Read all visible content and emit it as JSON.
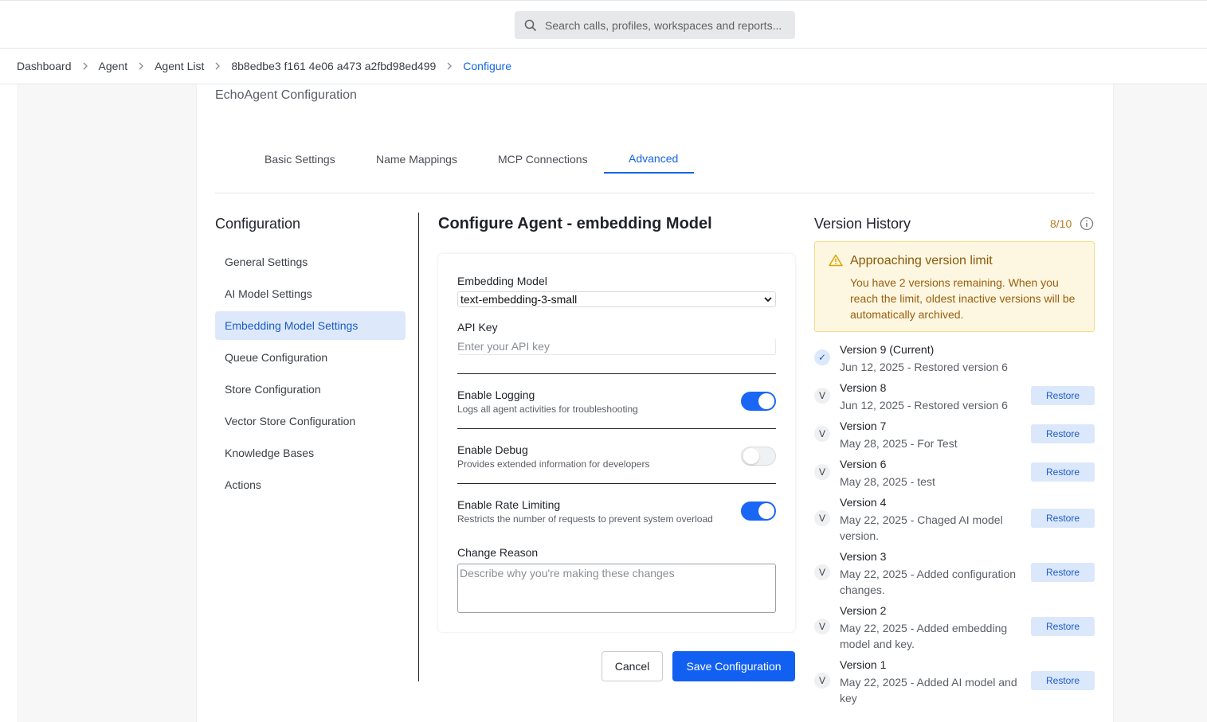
{
  "search": {
    "placeholder": "Search calls, profiles, workspaces and reports..."
  },
  "breadcrumb": {
    "items": [
      "Dashboard",
      "Agent",
      "Agent List",
      "8b8edbe3 f161 4e06 a473 a2fbd98ed499"
    ],
    "current": "Configure"
  },
  "page": {
    "title": "EchoAgent Configuration"
  },
  "tabs": [
    "Basic Settings",
    "Name Mappings",
    "MCP Connections",
    "Advanced"
  ],
  "active_tab": "Advanced",
  "sidebar": {
    "title": "Configuration",
    "items": [
      "General Settings",
      "AI Model Settings",
      "Embedding Model Settings",
      "Queue Configuration",
      "Store Configuration",
      "Vector Store Configuration",
      "Knowledge Bases",
      "Actions"
    ],
    "active": "Embedding Model Settings"
  },
  "form": {
    "title": "Configure Agent - embedding Model",
    "embedding_model_label": "Embedding Model",
    "embedding_model_value": "text-embedding-3-small",
    "api_key_label": "API Key",
    "api_key_placeholder": "Enter your API key",
    "toggles": [
      {
        "label": "Enable Logging",
        "desc": "Logs all agent activities for troubleshooting",
        "on": true
      },
      {
        "label": "Enable Debug",
        "desc": "Provides extended information for developers",
        "on": false
      },
      {
        "label": "Enable Rate Limiting",
        "desc": "Restricts the number of requests to prevent system overload",
        "on": true
      }
    ],
    "change_reason_label": "Change Reason",
    "change_reason_placeholder": "Describe why you're making these changes",
    "cancel_label": "Cancel",
    "save_label": "Save Configuration"
  },
  "version_history": {
    "title": "Version History",
    "count": "8/10",
    "warning_title": "Approaching version limit",
    "warning_text": "You have 2 versions remaining. When you reach the limit, oldest inactive versions will be automatically archived.",
    "restore_label": "Restore",
    "versions": [
      {
        "badge": "✓",
        "name": "Version 9 (Current)",
        "desc": "Jun 12, 2025 - Restored version 6",
        "current": true
      },
      {
        "badge": "V",
        "name": "Version 8",
        "desc": "Jun 12, 2025 - Restored version 6"
      },
      {
        "badge": "V",
        "name": "Version 7",
        "desc": "May 28, 2025 - For Test"
      },
      {
        "badge": "V",
        "name": "Version 6",
        "desc": "May 28, 2025 - test"
      },
      {
        "badge": "V",
        "name": "Version 4",
        "desc": "May 22, 2025 - Chaged AI model version."
      },
      {
        "badge": "V",
        "name": "Version 3",
        "desc": "May 22, 2025 - Added configuration changes."
      },
      {
        "badge": "V",
        "name": "Version 2",
        "desc": "May 22, 2025 - Added embedding model and key."
      },
      {
        "badge": "V",
        "name": "Version 1",
        "desc": "May 22, 2025 - Added AI model and key"
      }
    ]
  },
  "colors": {
    "accent": "#1565e0",
    "primary_button": "#1160f2",
    "warning_bg": "#fdf7e1",
    "warning_text": "#9a5d0c"
  }
}
